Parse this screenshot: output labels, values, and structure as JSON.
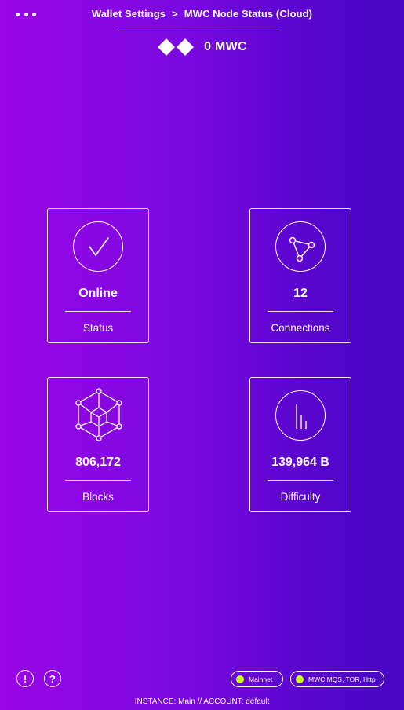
{
  "header": {
    "breadcrumb_parent": "Wallet Settings",
    "breadcrumb_separator": ">",
    "breadcrumb_current": "MWC Node Status (Cloud)",
    "balance": "0 MWC",
    "menu_icon": "more-dots-icon",
    "logo_icon": "mwc-logo-icon"
  },
  "cards": [
    {
      "icon": "checkmark-icon",
      "value": "Online",
      "label": "Status"
    },
    {
      "icon": "connections-icon",
      "value": "12",
      "label": "Connections"
    },
    {
      "icon": "cube-network-icon",
      "value": "806,172",
      "label": "Blocks"
    },
    {
      "icon": "bar-chart-icon",
      "value": "139,964 B",
      "label": "Difficulty"
    }
  ],
  "footer": {
    "info_icon_glyph": "!",
    "help_icon_glyph": "?",
    "network_label": "Mainnet",
    "transport_label": "MWC MQS, TOR, Http",
    "instance_line": "INSTANCE:  Main  //  ACCOUNT:  default",
    "status_dot_color": "#c6ff1c"
  },
  "colors": {
    "gradient_start": "#9a06e6",
    "gradient_end": "#4406c2",
    "foreground": "#ffffff"
  }
}
